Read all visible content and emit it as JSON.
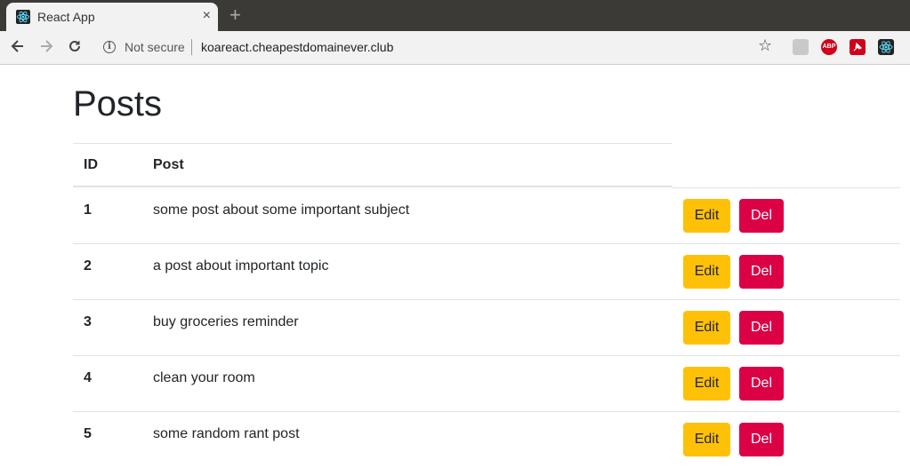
{
  "browser": {
    "tab_title": "React App",
    "tab_close": "×",
    "new_tab": "+",
    "security_label": "Not secure",
    "url": "koareact.cheapestdomainever.club",
    "extensions": [
      "user-icon",
      "adblock-plus-icon",
      "pin-icon",
      "react-devtools-icon"
    ],
    "abp_label": "ABP"
  },
  "page": {
    "title": "Posts",
    "columns": [
      "ID",
      "Post"
    ],
    "edit_label": "Edit",
    "del_label": "Del",
    "posts": [
      {
        "id": "1",
        "text": "some post about some important subject"
      },
      {
        "id": "2",
        "text": "a post about important topic"
      },
      {
        "id": "3",
        "text": "buy groceries reminder"
      },
      {
        "id": "4",
        "text": "clean your room"
      },
      {
        "id": "5",
        "text": "some random rant post"
      }
    ]
  },
  "colors": {
    "edit": "#ffc107",
    "del": "#dc0045",
    "text": "#212529"
  }
}
